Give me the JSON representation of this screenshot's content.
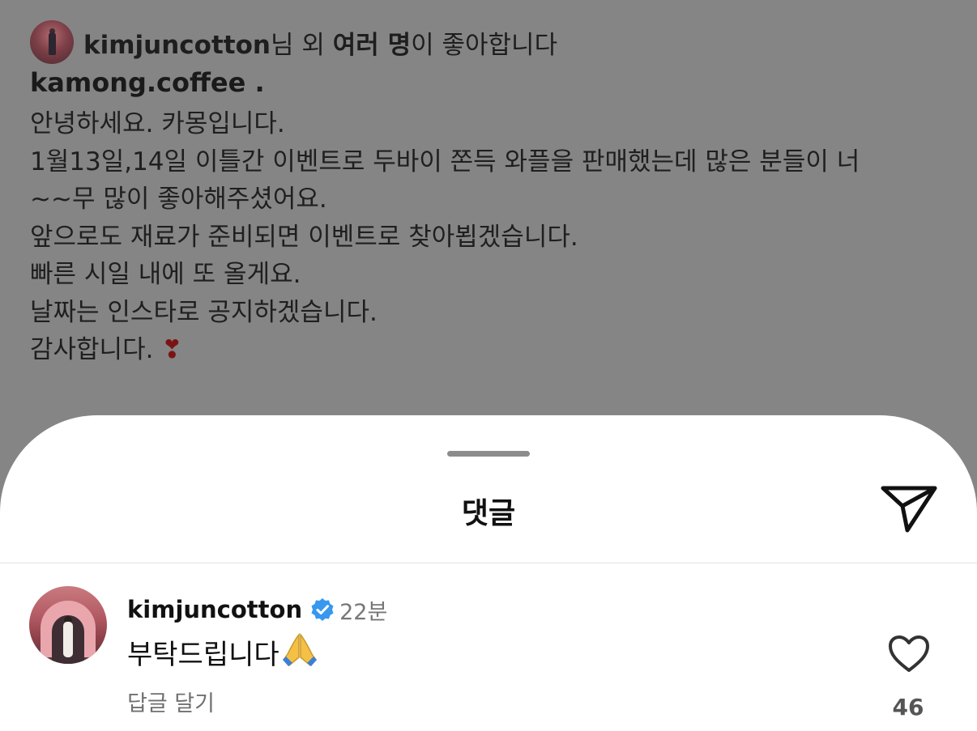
{
  "post": {
    "liked_by_user": "kimjuncotton",
    "liked_by_suffix": "님 외 ",
    "liked_by_others": "여러 명",
    "liked_by_end": "이 좋아합니다",
    "author": "kamong.coffee .",
    "lines": [
      "안녕하세요. 카몽입니다.",
      "1월13일,14일 이틀간 이벤트로 두바이 쫀득 와플을 판매했는데 많은 분들이 너",
      "~~무 많이 좋아해주셨어요.",
      "앞으로도 재료가 준비되면 이벤트로 찾아뵙겠습니다.",
      "빠른 시일 내에 또 올게요.",
      "날짜는 인스타로 공지하겠습니다.",
      "감사합니다."
    ],
    "closing_emoji": "❣"
  },
  "sheet": {
    "title": "댓글",
    "send_icon": "paper-plane-icon"
  },
  "comment": {
    "username": "kimjuncotton",
    "verified_icon": "verified-badge-icon",
    "time": "22분",
    "text": "부탁드립니다",
    "emoji": "pray-emoji",
    "reply_label": "답글 달기",
    "like_icon": "heart-outline-icon",
    "like_count": "46"
  },
  "colors": {
    "overlay": "#858585",
    "sheet_bg": "#ffffff",
    "verified": "#3897f0"
  }
}
